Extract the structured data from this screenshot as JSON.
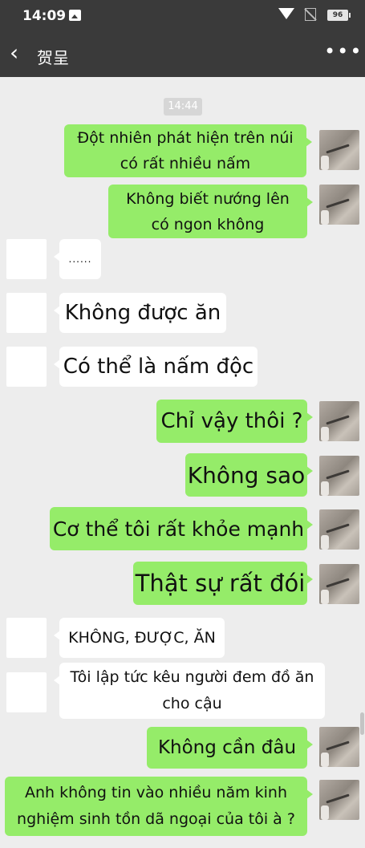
{
  "status_bar": {
    "time": "14:09",
    "battery": "96",
    "icons": [
      "image-icon",
      "wifi-icon",
      "no-sim-icon",
      "battery-icon"
    ]
  },
  "nav": {
    "back_icon": "‹",
    "title": "贺呈",
    "more_icon": "•••"
  },
  "chat": {
    "timestamp": "14:44",
    "messages": [
      {
        "side": "right",
        "text": "Đột nhiên phát hiện trên núi có rất nhiều nấm"
      },
      {
        "side": "right",
        "text": "Không biết nướng lên có ngon không"
      },
      {
        "side": "left",
        "text": "......"
      },
      {
        "side": "left",
        "text": "Không được ăn"
      },
      {
        "side": "left",
        "text": "Có thể là nấm độc"
      },
      {
        "side": "right",
        "text": "Chỉ vậy thôi ?"
      },
      {
        "side": "right",
        "text": "Không sao"
      },
      {
        "side": "right",
        "text": "Cơ thể tôi rất khỏe mạnh"
      },
      {
        "side": "right",
        "text": "Thật sự rất đói"
      },
      {
        "side": "left",
        "text": "KHÔNG, ĐƯỢC, ĂN"
      },
      {
        "side": "left",
        "text": "Tôi lập tức kêu người đem đồ ăn cho cậu"
      },
      {
        "side": "right",
        "text": "Không cần đâu"
      },
      {
        "side": "right",
        "text": "Anh không tin vào nhiều năm kinh nghiệm sinh tồn dã ngoại của tôi à ?"
      }
    ]
  },
  "colors": {
    "header_bg": "#3a3a3a",
    "chat_bg": "#ededed",
    "sent_bubble": "#95ec69",
    "received_bubble": "#ffffff"
  }
}
